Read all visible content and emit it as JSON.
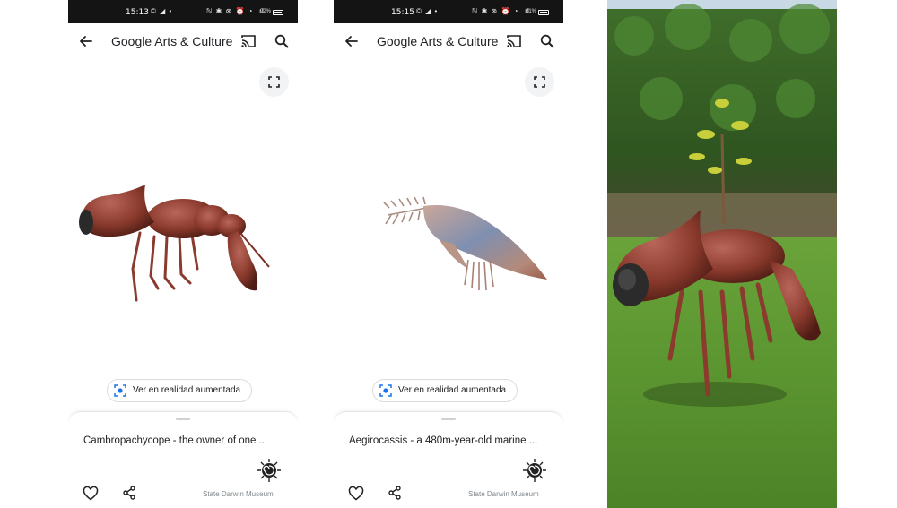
{
  "screens": [
    {
      "status": {
        "time": "15:13",
        "left_icons": "© ◢ •",
        "right_icons": "ℕ ✱ ⊗ ⏰ ◔ .ıl",
        "battery": "92%"
      },
      "app_title": "Google Arts & Culture",
      "ar_button_label": "Ver en realidad aumentada",
      "item_title": "Cambropachycope - the owner of one ...",
      "museum_name": "State Darwin Museum",
      "icons": {
        "back": "arrow-back-icon",
        "cast": "cast-icon",
        "search": "search-icon",
        "fullscreen": "fullscreen-icon",
        "ar": "ar-viewer-icon",
        "like": "heart-icon",
        "share": "share-icon",
        "museum": "museum-logo"
      }
    },
    {
      "status": {
        "time": "15:15",
        "left_icons": "© ◢ •",
        "right_icons": "ℕ ✱ ⊗ ⏰ ◔ .ıl",
        "battery": "91%"
      },
      "app_title": "Google Arts & Culture",
      "ar_button_label": "Ver en realidad aumentada",
      "item_title": "Aegirocassis - a 480m-year-old marine ...",
      "museum_name": "State Darwin Museum",
      "icons": {
        "back": "arrow-back-icon",
        "cast": "cast-icon",
        "search": "search-icon",
        "fullscreen": "fullscreen-icon",
        "ar": "ar-viewer-icon",
        "like": "heart-icon",
        "share": "share-icon",
        "museum": "museum-logo"
      }
    }
  ],
  "colors": {
    "status_bar": "#141414",
    "text_primary": "#202124",
    "text_secondary": "#80868b",
    "ar_icon_blue": "#1a73e8",
    "creature_brown": "#7a2f22",
    "grass_green": "#5a8f2e"
  }
}
